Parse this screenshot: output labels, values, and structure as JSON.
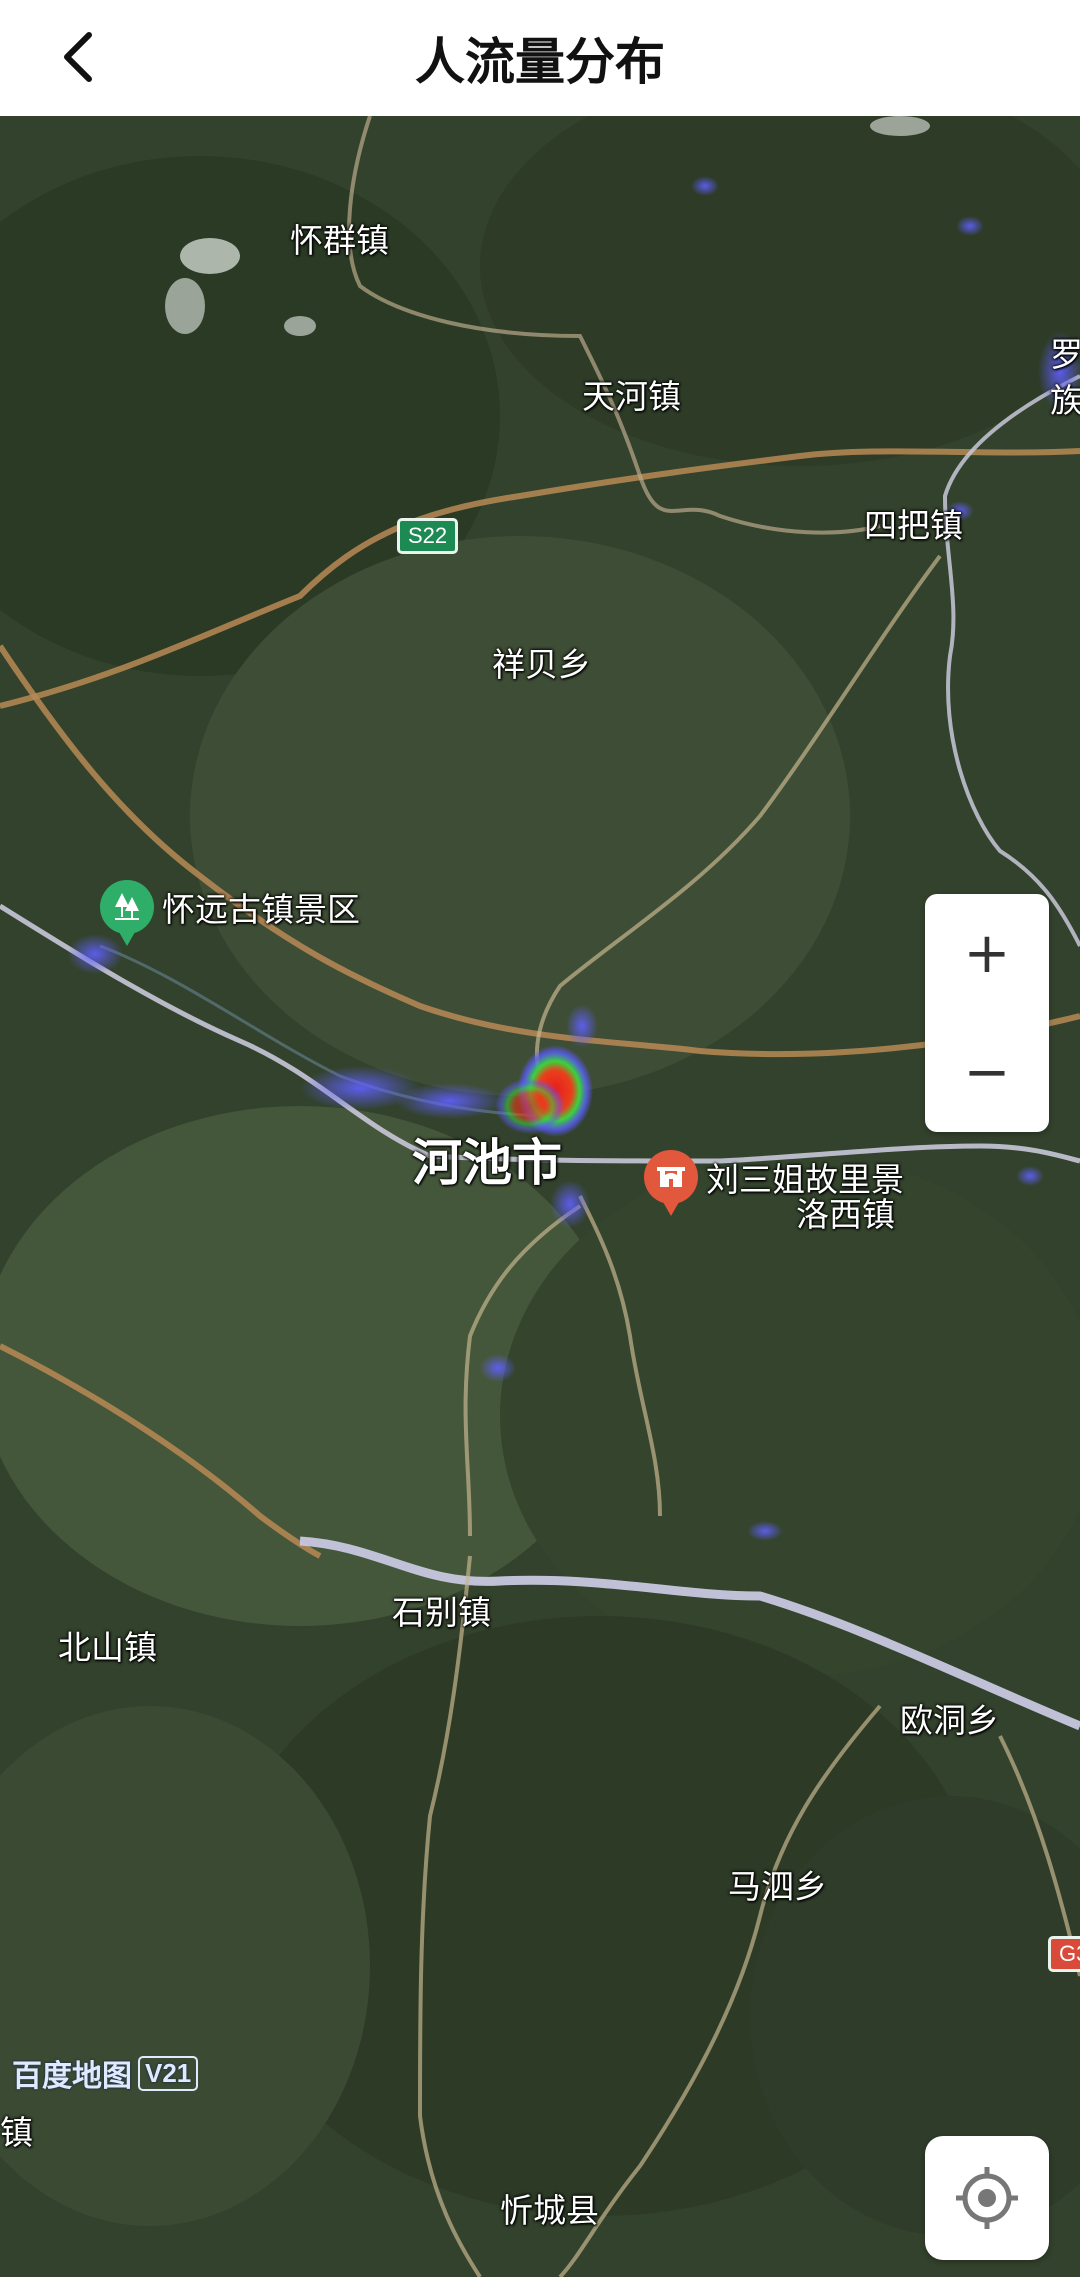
{
  "header": {
    "title": "人流量分布"
  },
  "map": {
    "watermark": {
      "brand": "百度地图",
      "version": "V21"
    },
    "road_shields": [
      {
        "code": "S22",
        "color": "#1e8a53"
      },
      {
        "code": "G3",
        "color": "#d94a3a"
      }
    ],
    "labels": {
      "huaiqun": "怀群镇",
      "tianhe": "天河镇",
      "luo_zu_top": "罗",
      "luo_zu_bottom": "族",
      "siba": "四把镇",
      "xiangbei": "祥贝乡",
      "hechi": "河池市",
      "luoxi": "洛西镇",
      "shibie": "石别镇",
      "beishan": "北山镇",
      "oudong": "欧洞乡",
      "masi": "马泗乡",
      "xincheng": "忻城县",
      "left_edge_zhen": "镇"
    },
    "pois": [
      {
        "name": "怀远古镇景区",
        "icon": "tree-icon",
        "color": "#2fae6a"
      },
      {
        "name": "刘三姐故里景",
        "icon": "landmark-icon",
        "color": "#e2583c"
      }
    ],
    "controls": {
      "zoom_in": "+",
      "zoom_out": "−"
    }
  },
  "heatmap": {
    "hotspot_color": "#e81c1c",
    "mid_color": "#3ad33a",
    "low_color": "#5a5aff"
  }
}
